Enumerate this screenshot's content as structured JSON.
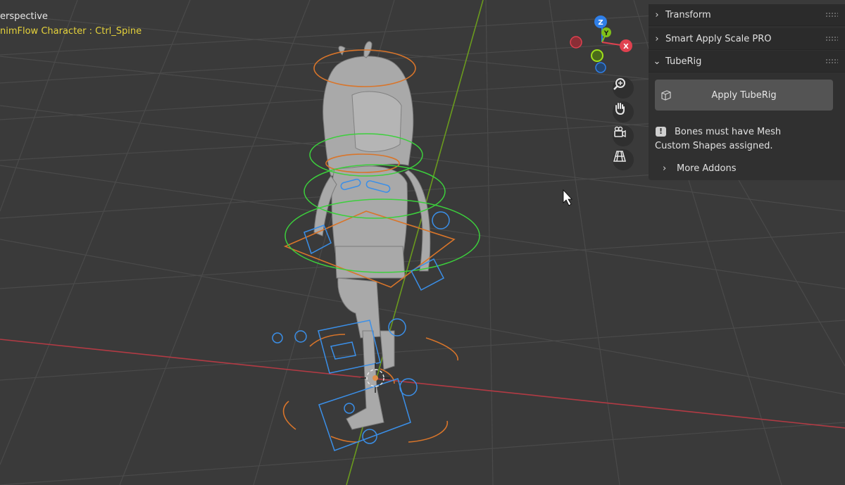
{
  "viewport": {
    "view_name": "erspective",
    "active_object": "nimFlow Character : Ctrl_Spine"
  },
  "gizmo": {
    "axis_z": "Z",
    "axis_y": "Y",
    "axis_x": "X",
    "colors": {
      "x": "#e0414f",
      "y": "#7fbf1a",
      "z": "#2f7fe8"
    }
  },
  "nav_buttons": [
    "zoom-icon",
    "pan-hand-icon",
    "camera-icon",
    "perspective-grid-icon"
  ],
  "panel": {
    "transform_label": "Transform",
    "smart_apply_label": "Smart Apply Scale PRO",
    "tuberig_label": "TubeRig",
    "apply_button_label": "Apply TubeRig",
    "info_line1": "Bones must have Mesh",
    "info_line2": "Custom Shapes assigned.",
    "more_addons_label": "More Addons"
  }
}
